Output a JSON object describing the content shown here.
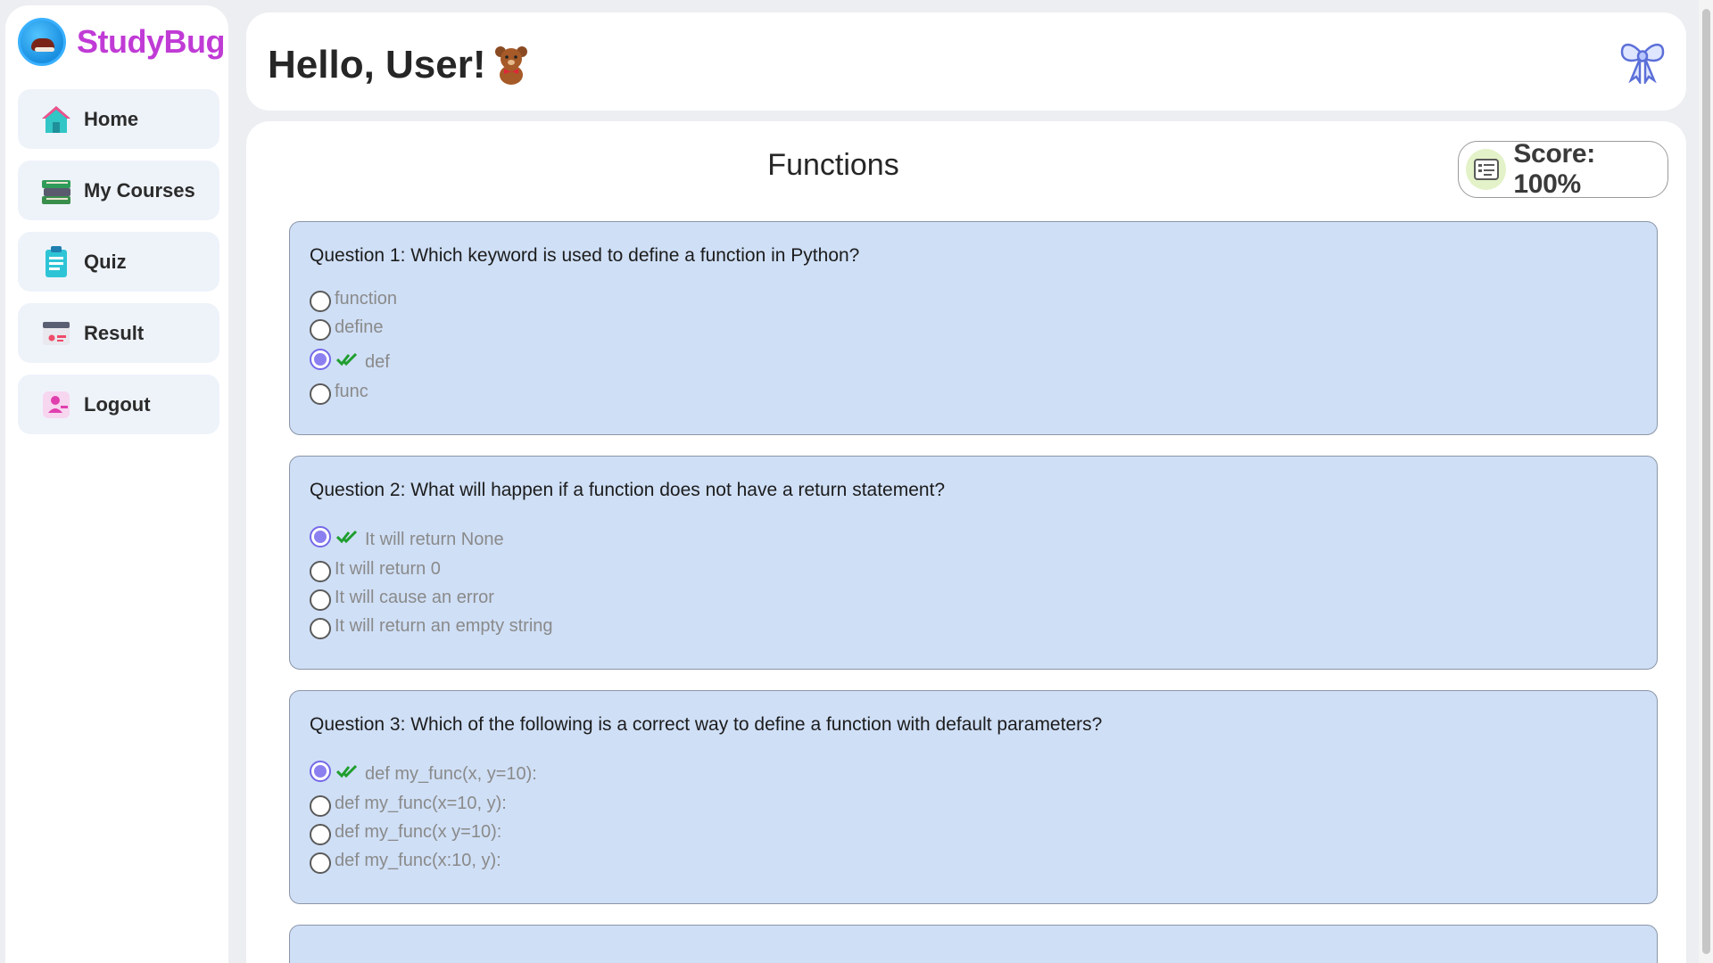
{
  "app": {
    "name": "StudyBug",
    "brand_color": "#c03bd6"
  },
  "sidebar": {
    "items": [
      {
        "label": "Home",
        "icon": "home-icon"
      },
      {
        "label": "My Courses",
        "icon": "books-icon"
      },
      {
        "label": "Quiz",
        "icon": "clipboard-icon"
      },
      {
        "label": "Result",
        "icon": "result-icon"
      },
      {
        "label": "Logout",
        "icon": "logout-icon"
      }
    ]
  },
  "header": {
    "greeting": "Hello, User!",
    "greeting_icon": "teddy-bear-icon",
    "right_icon": "bow-icon"
  },
  "main": {
    "title": "Functions",
    "score": {
      "label": "Score: 100%",
      "icon": "score-sheet-icon"
    },
    "questions": [
      {
        "text": "Question 1: Which keyword is used to define a function in Python?",
        "options": [
          "function",
          "define",
          "def",
          "func"
        ],
        "selected_index": 2,
        "selected_correct": true
      },
      {
        "text": "Question 2: What will happen if a function does not have a return statement?",
        "options": [
          "It will return None",
          "It will return 0",
          "It will cause an error",
          "It will return an empty string"
        ],
        "selected_index": 0,
        "selected_correct": true
      },
      {
        "text": "Question 3: Which of the following is a correct way to define a function with default parameters?",
        "options": [
          "def my_func(x, y=10):",
          "def my_func(x=10, y):",
          "def my_func(x y=10):",
          "def my_func(x:10, y):"
        ],
        "selected_index": 0,
        "selected_correct": true
      }
    ]
  },
  "colors": {
    "card_background": "#cfdff6",
    "radio_selected": "#8c80f0",
    "check_correct": "#1f9e2e"
  }
}
